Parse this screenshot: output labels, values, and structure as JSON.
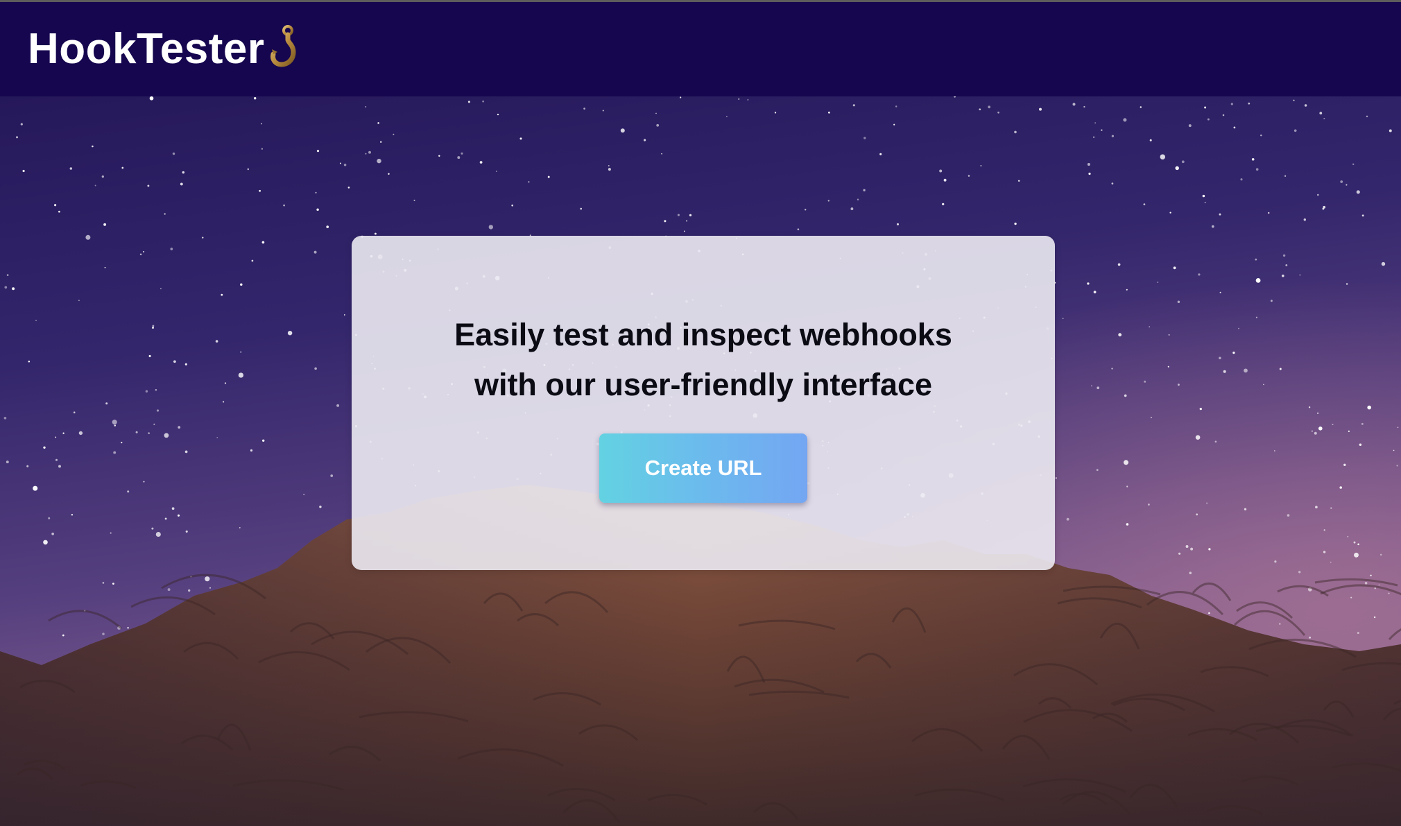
{
  "app": {
    "brand": "HookTester",
    "brand_icon": "hook-icon"
  },
  "hero": {
    "headline_line1": "Easily test and inspect webhooks",
    "headline_line2": "with our user-friendly interface",
    "cta_label": "Create URL",
    "background": "starry-night-mountain-image"
  },
  "colors": {
    "navbar": "#16064f",
    "sky_top": "#25185a",
    "sky_bottom": "#7a5a8e",
    "mountain": "#6b4235",
    "card": "#ecebf2",
    "button_gradient_start": "#63d2e2",
    "button_gradient_end": "#74a6f2",
    "headline": "#0b0b14"
  }
}
